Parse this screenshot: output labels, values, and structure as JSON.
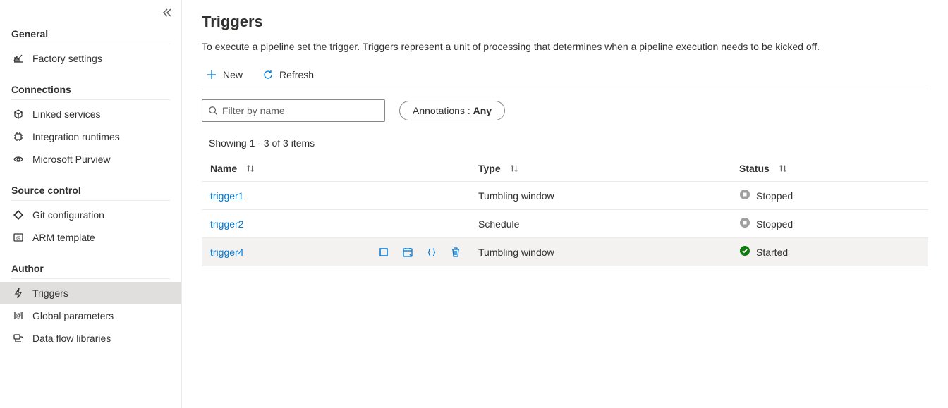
{
  "sidebar": {
    "sections": [
      {
        "heading": "General",
        "items": [
          {
            "label": "Factory settings",
            "icon": "chart"
          }
        ]
      },
      {
        "heading": "Connections",
        "items": [
          {
            "label": "Linked services",
            "icon": "cube-link"
          },
          {
            "label": "Integration runtimes",
            "icon": "runtime"
          },
          {
            "label": "Microsoft Purview",
            "icon": "eye"
          }
        ]
      },
      {
        "heading": "Source control",
        "items": [
          {
            "label": "Git configuration",
            "icon": "git"
          },
          {
            "label": "ARM template",
            "icon": "arm"
          }
        ]
      },
      {
        "heading": "Author",
        "items": [
          {
            "label": "Triggers",
            "icon": "bolt",
            "active": true
          },
          {
            "label": "Global parameters",
            "icon": "params"
          },
          {
            "label": "Data flow libraries",
            "icon": "dataflow"
          }
        ]
      }
    ]
  },
  "page": {
    "title": "Triggers",
    "description": "To execute a pipeline set the trigger. Triggers represent a unit of processing that determines when a pipeline execution needs to be kicked off."
  },
  "toolbar": {
    "new_label": "New",
    "refresh_label": "Refresh"
  },
  "filter": {
    "placeholder": "Filter by name",
    "annotations_label": "Annotations : ",
    "annotations_value": "Any"
  },
  "showing_text": "Showing 1 - 3 of 3 items",
  "columns": {
    "name": "Name",
    "type": "Type",
    "status": "Status"
  },
  "rows": [
    {
      "name": "trigger1",
      "type": "Tumbling window",
      "status": "Stopped",
      "hovered": false
    },
    {
      "name": "trigger2",
      "type": "Schedule",
      "status": "Stopped",
      "hovered": false
    },
    {
      "name": "trigger4",
      "type": "Tumbling window",
      "status": "Started",
      "hovered": true
    }
  ]
}
